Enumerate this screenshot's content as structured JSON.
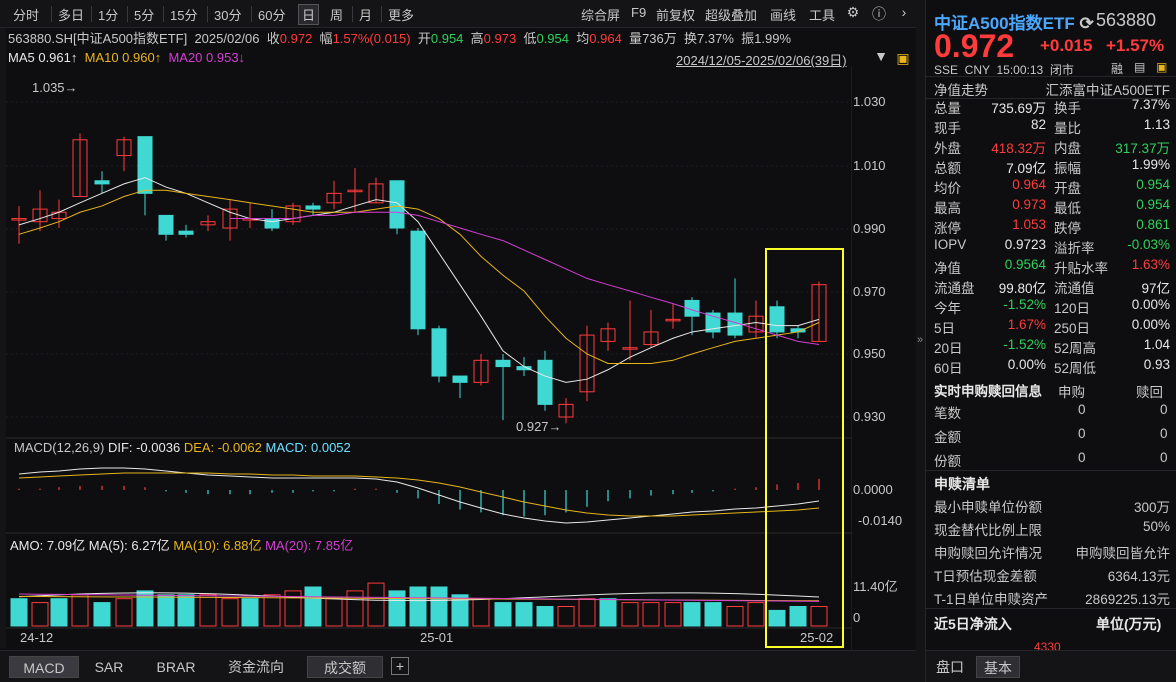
{
  "toolbar": {
    "periods": [
      "分时",
      "多日",
      "1分",
      "5分",
      "15分",
      "30分",
      "60分",
      "日",
      "周",
      "月",
      "更多"
    ],
    "active_period": "日",
    "tools": [
      "综合屏",
      "F9",
      "前复权",
      "超级叠加",
      "画线",
      "工具"
    ]
  },
  "info": {
    "code": "563880.SH[中证A500指数ETF]",
    "date": "2025/02/06",
    "close_label": "收",
    "close": "0.972",
    "amp_label": "幅",
    "amp": "1.57%(0.015)",
    "open_label": "开",
    "open": "0.954",
    "high_label": "高",
    "high": "0.973",
    "low_label": "低",
    "low": "0.954",
    "avg_label": "均",
    "avg": "0.964",
    "vol_label": "量",
    "vol": "736万",
    "turn_label": "换",
    "turn": "7.37%",
    "swing_label": "振",
    "swing": "1.99%"
  },
  "ma": {
    "ma5": "MA5 0.961↑",
    "ma10": "MA10 0.960↑",
    "ma20": "MA20 0.953↓"
  },
  "range_text": "2024/12/05-2025/02/06(39日)",
  "price_axis": [
    "1.030",
    "1.010",
    "0.990",
    "0.970",
    "0.950",
    "0.930"
  ],
  "annotations": {
    "high_mark": "1.035",
    "low_mark": "0.927"
  },
  "macd": {
    "title": "MACD(12,26,9)",
    "dif": "DIF: -0.0036",
    "dea": "DEA: -0.0062",
    "macd": "MACD: 0.0052",
    "axis": [
      "0.0000",
      "-0.0140"
    ]
  },
  "amo": {
    "title": "AMO: 7.09亿",
    "ma5": "MA(5): 6.27亿",
    "ma10": "MA(10): 6.88亿",
    "ma20": "MA(20): 7.85亿",
    "axis": [
      "11.40亿",
      "0"
    ]
  },
  "date_axis": [
    "24-12",
    "25-01",
    "25-02"
  ],
  "bottom_tabs": [
    "MACD",
    "SAR",
    "BRAR",
    "资金流向",
    "成交额"
  ],
  "active_bottom_tab": "成交额",
  "colors": {
    "up": "#ff3b3b",
    "down": "#3fd8d2",
    "ma5": "#e8e8e8",
    "ma10": "#e8b41a",
    "ma20": "#d33fd3",
    "highlight": "#ffff2a"
  },
  "right": {
    "name": "中证A500指数ETF",
    "code": "563880",
    "price": "0.972",
    "change": "+0.015",
    "change_pct": "+1.57%",
    "meta": "SSE  CNY  15:00:13  闭市",
    "meta_badge": "融",
    "nav_trend_label": "净值走势",
    "fund_name": "汇添富中证A500ETF",
    "stats": [
      {
        "l1": "总量",
        "v1": "735.69万",
        "c1": "w",
        "l2": "换手",
        "v2": "7.37%",
        "c2": "w"
      },
      {
        "l1": "现手",
        "v1": "82",
        "c1": "w",
        "l2": "量比",
        "v2": "1.13",
        "c2": "w"
      },
      {
        "l1": "外盘",
        "v1": "418.32万",
        "c1": "r",
        "l2": "内盘",
        "v2": "317.37万",
        "c2": "g"
      },
      {
        "l1": "总额",
        "v1": "7.09亿",
        "c1": "w",
        "l2": "振幅",
        "v2": "1.99%",
        "c2": "w"
      },
      {
        "l1": "均价",
        "v1": "0.964",
        "c1": "r",
        "l2": "开盘",
        "v2": "0.954",
        "c2": "g"
      },
      {
        "l1": "最高",
        "v1": "0.973",
        "c1": "r",
        "l2": "最低",
        "v2": "0.954",
        "c2": "g"
      },
      {
        "l1": "涨停",
        "v1": "1.053",
        "c1": "r",
        "l2": "跌停",
        "v2": "0.861",
        "c2": "g"
      },
      {
        "l1": "IOPV",
        "v1": "0.9723",
        "c1": "w",
        "l2": "溢折率",
        "v2": "-0.03%",
        "c2": "g"
      },
      {
        "l1": "净值",
        "v1": "0.9564",
        "c1": "g",
        "l2": "升贴水率",
        "v2": "1.63%",
        "c2": "r"
      },
      {
        "l1": "流通盘",
        "v1": "99.80亿",
        "c1": "w",
        "l2": "流通值",
        "v2": "97亿",
        "c2": "w"
      },
      {
        "l1": "今年",
        "v1": "-1.52%",
        "c1": "g",
        "l2": "120日",
        "v2": "0.00%",
        "c2": "w"
      },
      {
        "l1": "5日",
        "v1": "1.67%",
        "c1": "r",
        "l2": "250日",
        "v2": "0.00%",
        "c2": "w"
      },
      {
        "l1": "20日",
        "v1": "-1.52%",
        "c1": "g",
        "l2": "52周高",
        "v2": "1.04",
        "c2": "w"
      },
      {
        "l1": "60日",
        "v1": "0.00%",
        "c1": "w",
        "l2": "52周低",
        "v2": "0.93",
        "c2": "w"
      }
    ],
    "redeem_title": "实时申购赎回信息",
    "redeem_cols": [
      "申购",
      "赎回"
    ],
    "redeem_rows": [
      {
        "label": "笔数",
        "a": "0",
        "b": "0"
      },
      {
        "label": "金额",
        "a": "0",
        "b": "0"
      },
      {
        "label": "份额",
        "a": "0",
        "b": "0"
      }
    ],
    "list_title": "申赎清单",
    "list_rows": [
      {
        "label": "最小申赎单位份额",
        "value": "300万"
      },
      {
        "label": "现金替代比例上限",
        "value": "50%"
      },
      {
        "label": "申购赎回允许情况",
        "value": "申购赎回皆允许"
      },
      {
        "label": "T日预估现金差额",
        "value": "6364.13元"
      },
      {
        "label": "T-1日单位申赎资产",
        "value": "2869225.13元"
      }
    ],
    "flow_title": "近5日净流入",
    "flow_unit": "单位(万元)",
    "flow_first": "4330",
    "tabs": [
      "盘口",
      "基本"
    ]
  }
}
